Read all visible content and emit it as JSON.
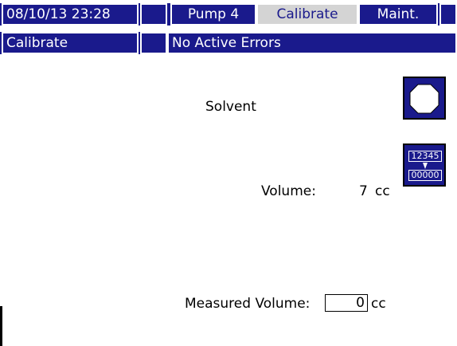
{
  "header": {
    "datetime": "08/10/13 23:28",
    "tabs": [
      "Pump 4",
      "Calibrate",
      "Maint."
    ],
    "screen_name": "Calibrate",
    "status": "No Active Errors"
  },
  "main": {
    "material": "Solvent",
    "volume_label": "Volume:",
    "volume_value": "7",
    "volume_unit": "cc",
    "measured_label": "Measured Volume:",
    "measured_value": "0",
    "measured_unit": "cc"
  },
  "buttons": {
    "reset_icon_top": "12345",
    "reset_icon_bottom": "00000"
  },
  "colors": {
    "bar": "#1a1a8c",
    "active_tab": "#d4d4d4"
  },
  "icons": [
    "stop-octagon-icon",
    "reset-counter-icon",
    "arrow-down-icon"
  ]
}
